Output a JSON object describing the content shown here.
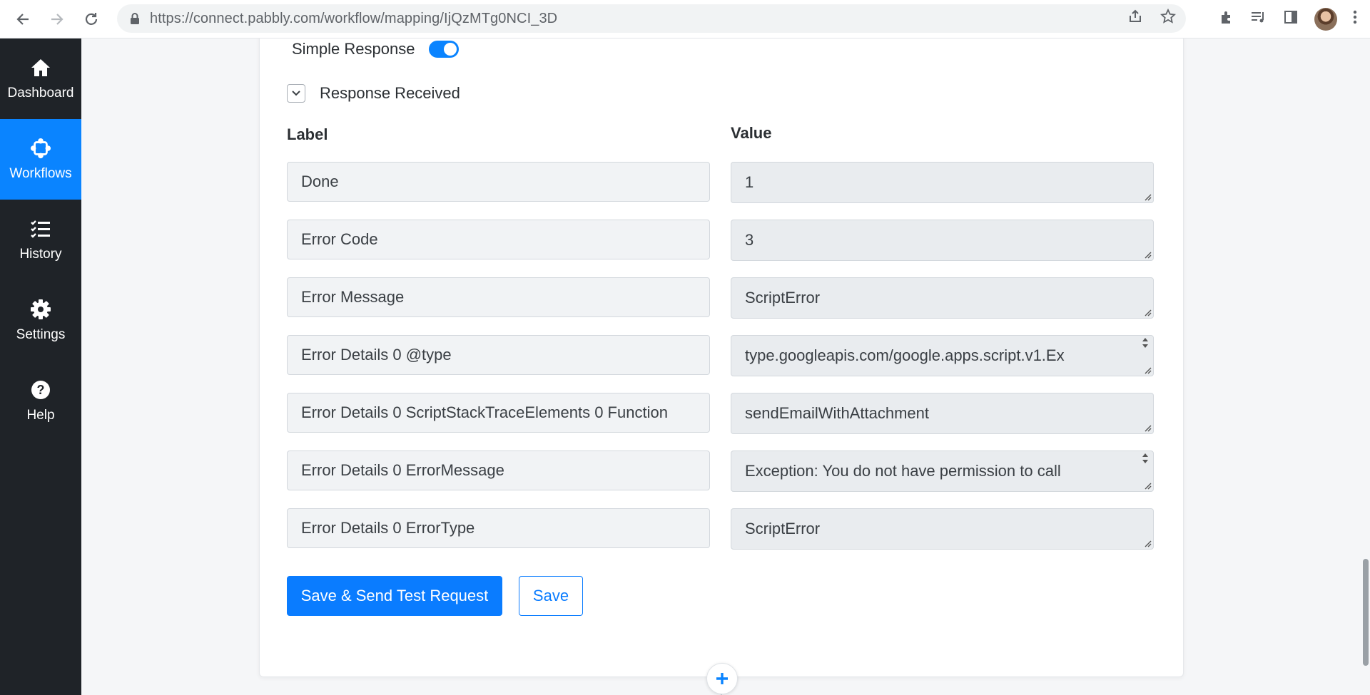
{
  "browser": {
    "url": "https://connect.pabbly.com/workflow/mapping/IjQzMTg0NCI_3D",
    "icons": [
      "back-icon",
      "forward-icon",
      "reload-icon",
      "lock-icon",
      "share-icon",
      "star-icon",
      "extensions-icon",
      "media-icon",
      "sidepanel-icon",
      "menu-icon"
    ]
  },
  "sidebar": {
    "items": [
      {
        "label": "Dashboard",
        "icon": "home-icon",
        "active": false
      },
      {
        "label": "Workflows",
        "icon": "workflow-icon",
        "active": true
      },
      {
        "label": "History",
        "icon": "history-icon",
        "active": false
      },
      {
        "label": "Settings",
        "icon": "gear-icon",
        "active": false
      },
      {
        "label": "Help",
        "icon": "help-icon",
        "active": false
      }
    ]
  },
  "form": {
    "simple_response_label": "Simple Response",
    "simple_response_on": true,
    "response_received_label": "Response Received",
    "label_header": "Label",
    "value_header": "Value",
    "rows": [
      {
        "label": "Done",
        "value": "1"
      },
      {
        "label": "Error Code",
        "value": "3"
      },
      {
        "label": "Error Message",
        "value": "ScriptError"
      },
      {
        "label": "Error Details 0 @type",
        "value": "type.googleapis.com/google.apps.script.v1.Ex"
      },
      {
        "label": "Error Details 0 ScriptStackTraceElements 0 Function",
        "value": "sendEmailWithAttachment"
      },
      {
        "label": "Error Details 0 ErrorMessage",
        "value": "Exception: You do not have permission to call"
      },
      {
        "label": "Error Details 0 ErrorType",
        "value": "ScriptError"
      }
    ],
    "save_send_label": "Save & Send Test Request",
    "save_label": "Save"
  },
  "accent_color": "#0a84ff"
}
